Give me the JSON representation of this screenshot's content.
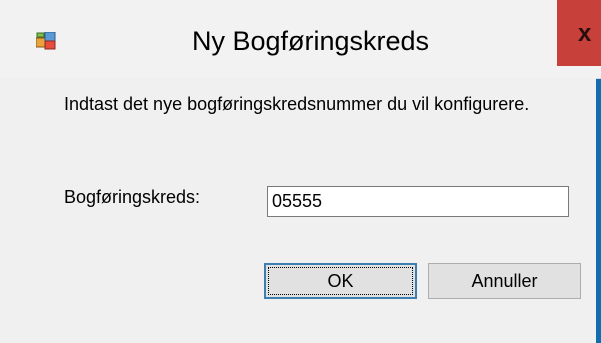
{
  "window": {
    "title": "Ny Bogføringskreds",
    "icon": "app-icon",
    "close_label": "x",
    "frame_color": "#0f6fae",
    "close_color": "#c7413a"
  },
  "dialog": {
    "instruction": "Indtast det nye bogføringskredsnummer du vil konfigurere.",
    "field_label": "Bogføringskreds:",
    "field_value": "05555",
    "ok_label": "OK",
    "cancel_label": "Annuller"
  }
}
